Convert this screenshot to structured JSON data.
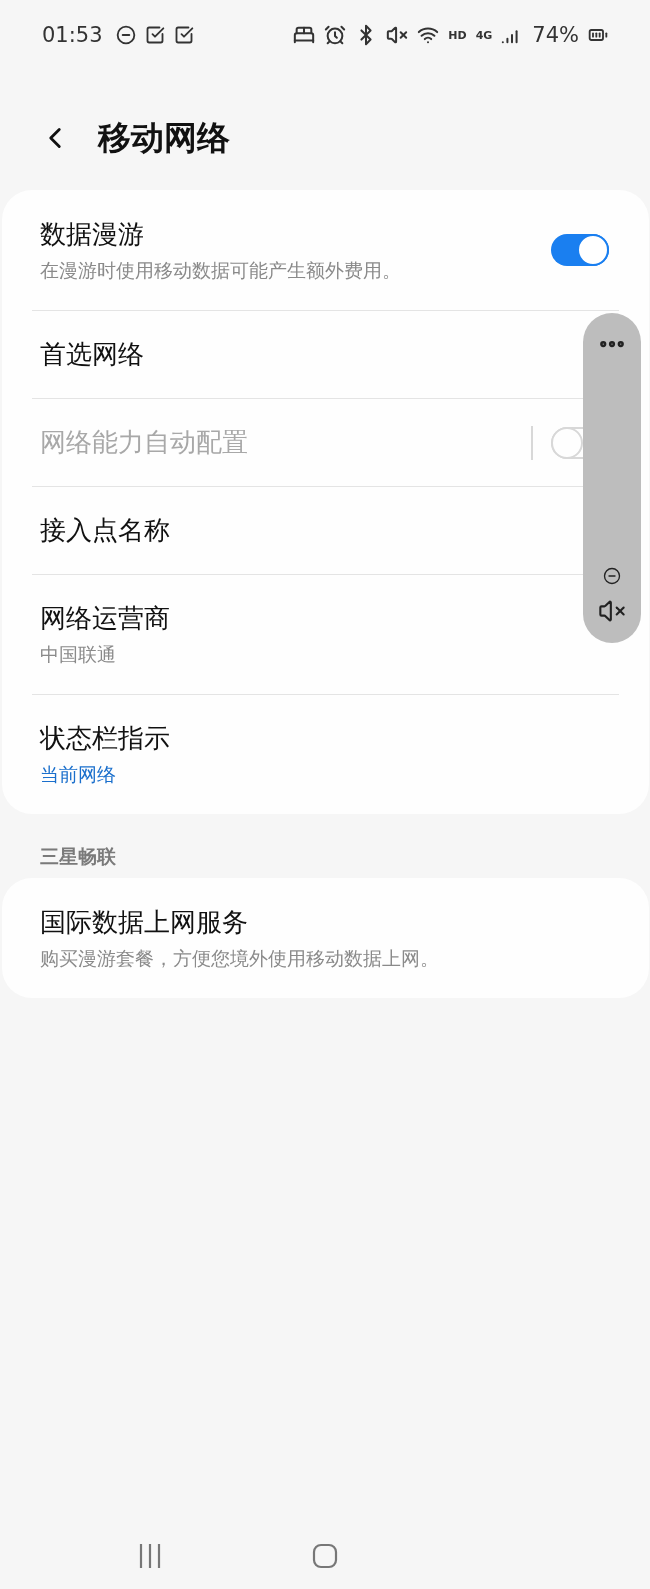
{
  "status_bar": {
    "time": "01:53",
    "network_badges": [
      "HD",
      "4G"
    ],
    "battery": "74%"
  },
  "header": {
    "title": "移动网络"
  },
  "sections": [
    {
      "items": [
        {
          "kind": "toggle",
          "title": "数据漫游",
          "summary": "在漫游时使用移动数据可能产生额外费用。",
          "summary_accent": false,
          "on": true,
          "disabled": false,
          "divided": false
        },
        {
          "kind": "link",
          "title": "首选网络",
          "disabled": false
        },
        {
          "kind": "toggle",
          "title": "网络能力自动配置",
          "on": false,
          "disabled": true,
          "divided": true
        },
        {
          "kind": "link",
          "title": "接入点名称",
          "disabled": false
        },
        {
          "kind": "link",
          "title": "网络运营商",
          "summary": "中国联通",
          "summary_accent": false,
          "disabled": false
        },
        {
          "kind": "link",
          "title": "状态栏指示",
          "summary": "当前网络",
          "summary_accent": true,
          "disabled": false
        }
      ]
    },
    {
      "label": "三星畅联",
      "items": [
        {
          "kind": "link",
          "title": "国际数据上网服务",
          "summary": "购买漫游套餐，方便您境外使用移动数据上网。",
          "summary_accent": false,
          "disabled": false
        }
      ]
    }
  ]
}
